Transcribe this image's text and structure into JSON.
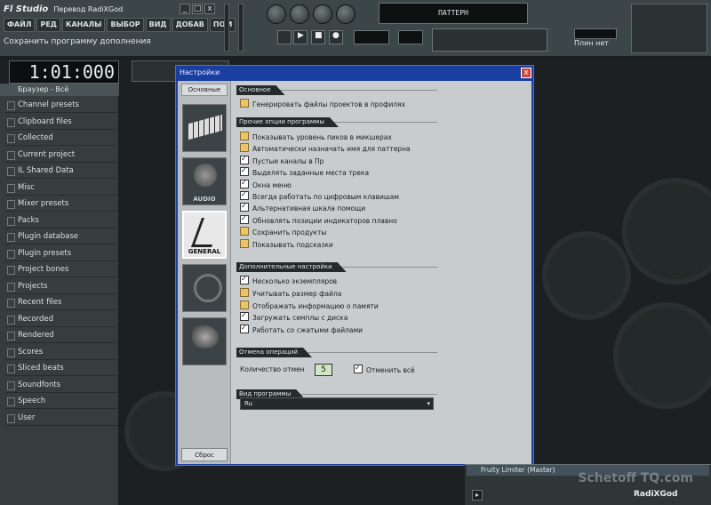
{
  "app": {
    "title": "Fl Studio",
    "project_title": "Перевод RadiXGod",
    "menu": [
      "ФАЙЛ",
      "РЕД",
      "КАНАЛЫ",
      "ВЫБОР",
      "ВИД",
      "ДОБАВ",
      "ПОМ"
    ],
    "tools_row": [
      "ФАЙЛ",
      "РЕД",
      "КАНАЛЫ",
      "ВЫБОР",
      "ВИД",
      "ДОБАВ",
      "ПОМ"
    ],
    "hint": "Сохранить программу дополнения",
    "time": "1:01:000",
    "top_right_label": "Плин нет",
    "pattern_label": "ПАТТЕРН"
  },
  "browser": {
    "header": "Браузер - Всё",
    "items": [
      "Channel presets",
      "Clipboard files",
      "Collected",
      "Current project",
      "IL Shared Data",
      "Misc",
      "Mixer presets",
      "Packs",
      "Plugin database",
      "Plugin presets",
      "Project bones",
      "Projects",
      "Recent files",
      "Recorded",
      "Rendered",
      "Scores",
      "Sliced beats",
      "Soundfonts",
      "Speech",
      "User"
    ]
  },
  "dialog": {
    "title": "Настройки",
    "close": "x",
    "tab_header": "Основные",
    "tabs": [
      {
        "label": "",
        "icon": "midi-keyboard-icon"
      },
      {
        "label": "AUDIO",
        "icon": "speaker-icon"
      },
      {
        "label": "GENERAL",
        "icon": "general-tools-icon"
      },
      {
        "label": "",
        "icon": "file-settings-icon"
      },
      {
        "label": "",
        "icon": "info-icon"
      }
    ],
    "reset_label": "Сброс",
    "groups": {
      "general": {
        "title": "Основное",
        "options": [
          {
            "label": "Генерировать файлы проектов в профилях",
            "checked": false
          }
        ]
      },
      "misc": {
        "title": "Прочие опции программы",
        "options": [
          {
            "label": "Показывать уровень пиков в микшерах",
            "checked": false
          },
          {
            "label": "Автоматически назначать имя для паттерна",
            "checked": false
          },
          {
            "label": "Пустые каналы в Пр",
            "checked": true
          },
          {
            "label": "Выделять заданные места трека",
            "checked": true
          },
          {
            "label": "Окна меню",
            "checked": true
          },
          {
            "label": "Всегда работать по цифровым клавишам",
            "checked": true
          },
          {
            "label": "Альтернативная шкала помощи",
            "checked": true
          },
          {
            "label": "Обновлять позиции индикаторов плавно",
            "checked": true
          },
          {
            "label": "Сохранить продукты",
            "checked": false
          },
          {
            "label": "Показывать подсказки",
            "checked": false
          }
        ]
      },
      "extra": {
        "title": "Дополнительные настройки",
        "options": [
          {
            "label": "Несколько экземпляров",
            "checked": true
          },
          {
            "label": "Учитывать размер файла",
            "checked": false
          },
          {
            "label": "Отображать информацию о памяти",
            "checked": false
          },
          {
            "label": "Загружать семплы с диска",
            "checked": true
          },
          {
            "label": "Работать со сжатыми файлами",
            "checked": true
          }
        ]
      },
      "undo": {
        "title": "Отмена операций",
        "levels_label": "Количество отмен",
        "levels_value": "5",
        "option_label": "Отменить всё",
        "option_checked": true
      },
      "language": {
        "title": "Вид программы",
        "value": "Ru"
      }
    }
  },
  "bottom_panel": {
    "title": "Fruity Limiter (Master)",
    "name": "RadiXGod"
  },
  "watermark": "Schetoff TQ.com",
  "colors": {
    "dialog_title_bar": "#1b3fa0",
    "dialog_body": "#c9cccf",
    "toolbar": "#3c4547",
    "browser": "#353d3f"
  }
}
